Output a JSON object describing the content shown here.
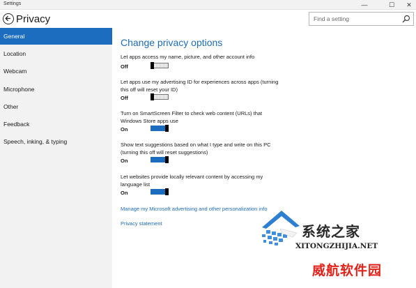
{
  "window": {
    "title": "Settings",
    "controls": {
      "minimize": "—",
      "maximize": "☐",
      "close": "✕"
    }
  },
  "header": {
    "title": "Privacy",
    "back_icon": "back-arrow-icon"
  },
  "search": {
    "placeholder": "Find a setting",
    "icon": "search-icon"
  },
  "sidebar": {
    "items": [
      {
        "label": "General",
        "active": true
      },
      {
        "label": "Location",
        "active": false
      },
      {
        "label": "Webcam",
        "active": false
      },
      {
        "label": "Microphone",
        "active": false
      },
      {
        "label": "Other",
        "active": false
      },
      {
        "label": "Feedback",
        "active": false
      },
      {
        "label": "Speech, inking, & typing",
        "active": false
      }
    ]
  },
  "main": {
    "heading": "Change privacy options",
    "settings": [
      {
        "desc": "Let apps access my name, picture, and other account info",
        "state": "Off"
      },
      {
        "desc": "Let apps use my advertising ID for experiences across apps (turning this off will reset your ID)",
        "state": "Off"
      },
      {
        "desc": "Turn on SmartScreen Filter to check web content (URLs) that Windows Store apps use",
        "state": "On"
      },
      {
        "desc": "Show text suggestions based on what I type and write on this PC (turning this off will reset suggestions)",
        "state": "On"
      },
      {
        "desc": "Let websites provide locally relevant content by accessing my language list",
        "state": "On"
      }
    ],
    "links": [
      "Manage my Microsoft advertising and other personalization info",
      "Privacy statement"
    ]
  },
  "watermark": {
    "site_name": "系统之家",
    "domain": "XITONGZHIJIA.NET",
    "secondary": "威航软件园"
  },
  "colors": {
    "accent": "#1c6cbf",
    "link": "#1e6bb8",
    "sidebar_bg": "#f2f2f2",
    "watermark_red": "#e2231a"
  }
}
